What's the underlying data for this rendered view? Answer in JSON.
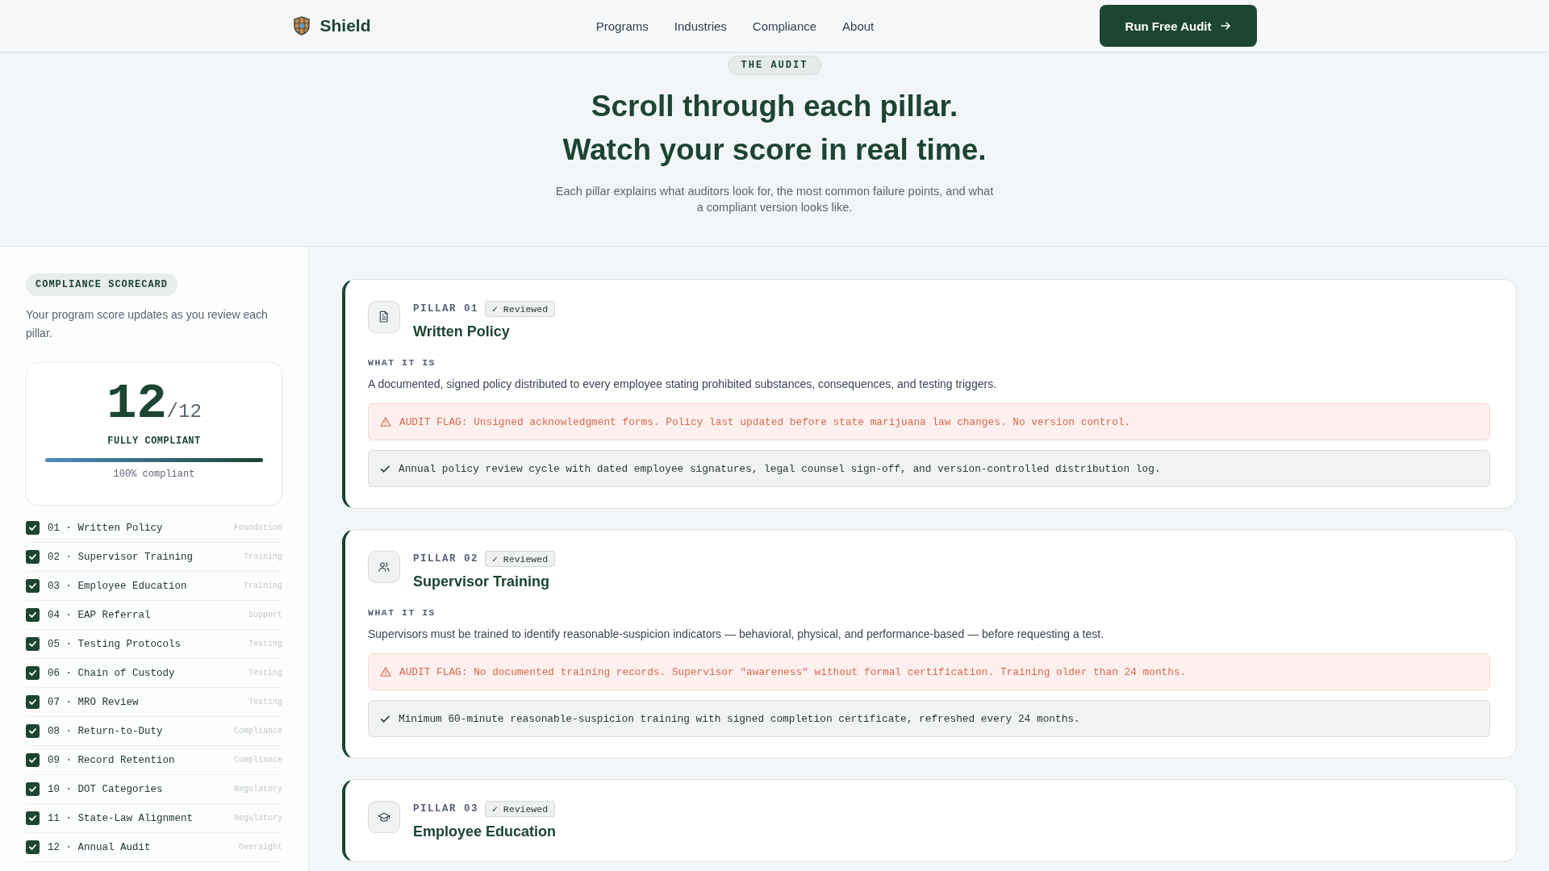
{
  "header": {
    "brand": "Shield",
    "nav": [
      "Programs",
      "Industries",
      "Compliance",
      "About"
    ],
    "cta": "Run Free Audit"
  },
  "hero": {
    "eyebrow": "THE AUDIT",
    "title_lines": [
      "Scroll through each pillar.",
      "Watch your score in real time."
    ],
    "subtitle": "Each pillar explains what auditors look for, the most common failure points, and what a compliant version looks like."
  },
  "sidebar": {
    "badge": "COMPLIANCE SCORECARD",
    "description": "Your program score updates as you review each pillar.",
    "scorecard": {
      "score": "12",
      "total": "/12",
      "status": "FULLY COMPLIANT",
      "level": 1,
      "reading": "100% compliant"
    },
    "pillars": [
      {
        "label": "01 · Written Policy",
        "category": "Foundation",
        "checked": true
      },
      {
        "label": "02 · Supervisor Training",
        "category": "Training",
        "checked": true
      },
      {
        "label": "03 · Employee Education",
        "category": "Training",
        "checked": true
      },
      {
        "label": "04 · EAP Referral",
        "category": "Support",
        "checked": true
      },
      {
        "label": "05 · Testing Protocols",
        "category": "Testing",
        "checked": true
      },
      {
        "label": "06 · Chain of Custody",
        "category": "Testing",
        "checked": true
      },
      {
        "label": "07 · MRO Review",
        "category": "Testing",
        "checked": true
      },
      {
        "label": "08 · Return-to-Duty",
        "category": "Compliance",
        "checked": true
      },
      {
        "label": "09 · Record Retention",
        "category": "Compliance",
        "checked": true
      },
      {
        "label": "10 · DOT Categories",
        "category": "Regulatory",
        "checked": true
      },
      {
        "label": "11 · State-Law Alignment",
        "category": "Regulatory",
        "checked": true
      },
      {
        "label": "12 · Annual Audit",
        "category": "Oversight",
        "checked": true
      }
    ]
  },
  "pillars": [
    {
      "kind": "document",
      "label": "PILLAR 01",
      "status": "✓ Reviewed",
      "title": "Written Policy",
      "section_label": "WHAT IT IS",
      "description": "A documented, signed policy distributed to every employee stating prohibited substances, consequences, and testing triggers.",
      "flag": "AUDIT FLAG: Unsigned acknowledgment forms. Policy last updated before state marijuana law changes. No version control.",
      "fix": "Annual policy review cycle with dated employee signatures, legal counsel sign-off, and version-controlled distribution log."
    },
    {
      "kind": "people",
      "label": "PILLAR 02",
      "status": "✓ Reviewed",
      "title": "Supervisor Training",
      "section_label": "WHAT IT IS",
      "description": "Supervisors must be trained to identify reasonable-suspicion indicators — behavioral, physical, and performance-based — before requesting a test.",
      "flag": "AUDIT FLAG: No documented training records. Supervisor \"awareness\" without formal certification. Training older than 24 months.",
      "fix": "Minimum 60-minute reasonable-suspicion training with signed completion certificate, refreshed every 24 months."
    },
    {
      "kind": "cap",
      "label": "PILLAR 03",
      "status": "✓ Reviewed",
      "title": "Employee Education"
    }
  ]
}
